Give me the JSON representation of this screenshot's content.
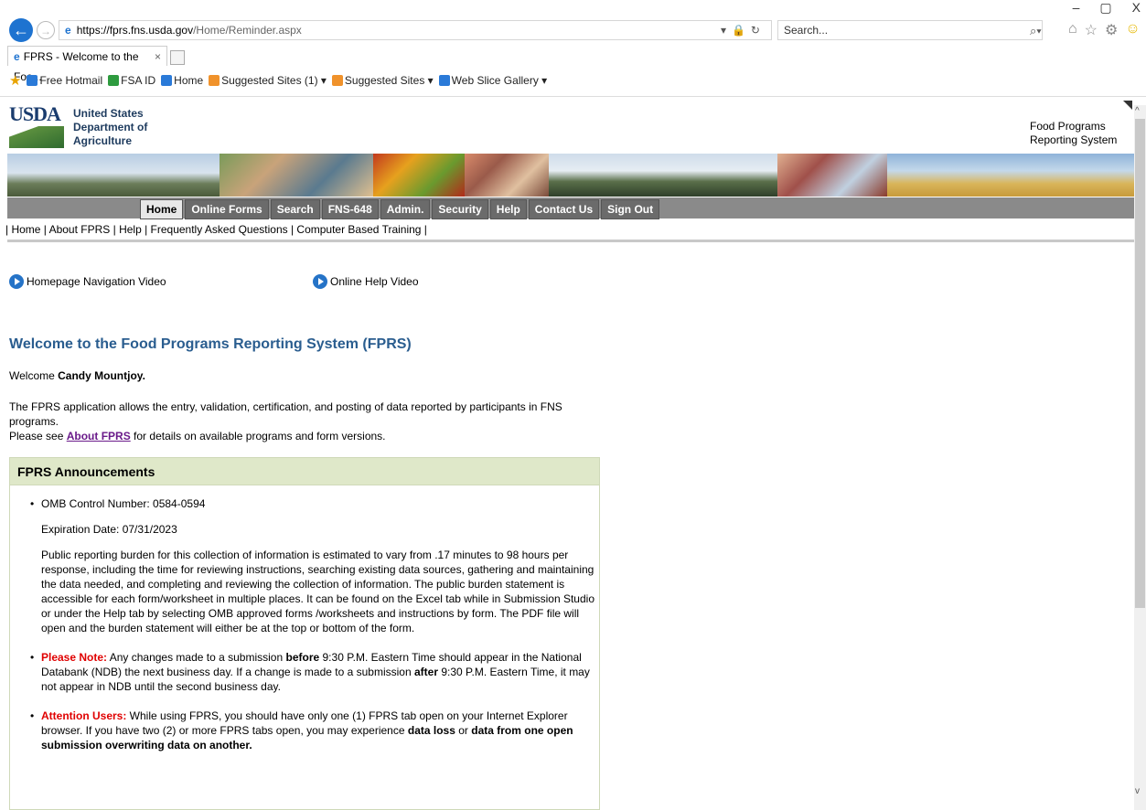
{
  "window": {
    "minimize": "–",
    "restore": "▢",
    "close": "X"
  },
  "browser": {
    "url_host": "https://fprs.fns.usda.gov",
    "url_path": "/Home/Reminder.aspx",
    "search_placeholder": "Search...",
    "tab_title": "FPRS - Welcome to the Foo...",
    "tab_close": "×",
    "favorites": [
      {
        "label": "Free Hotmail",
        "icon": "ie-icon"
      },
      {
        "label": "FSA ID",
        "icon": "fsa-icon"
      },
      {
        "label": "Home",
        "icon": "ie-icon"
      },
      {
        "label": "Suggested Sites (1) ▾",
        "icon": "suggested-sites-icon"
      },
      {
        "label": "Suggested Sites ▾",
        "icon": "suggested-sites-icon"
      },
      {
        "label": "Web Slice Gallery ▾",
        "icon": "ie-icon"
      }
    ]
  },
  "header": {
    "logo_text": "USDA",
    "dept_line1": "United States",
    "dept_line2": "Department of",
    "dept_line3": "Agriculture",
    "system_line1": "Food Programs",
    "system_line2": "Reporting System"
  },
  "nav": {
    "items": [
      "Home",
      "Online Forms",
      "Search",
      "FNS-648",
      "Admin.",
      "Security",
      "Help",
      "Contact Us",
      "Sign Out"
    ],
    "active": "Home"
  },
  "subnav": "| Home | About FPRS | Help | Frequently Asked Questions | Computer Based Training |",
  "videos": {
    "homepage": "Homepage Navigation Video",
    "help": "Online Help Video"
  },
  "welcome": {
    "title": "Welcome to the Food Programs Reporting System (FPRS)",
    "prefix": "Welcome ",
    "user": "Candy Mountjoy.",
    "intro_line1": "The FPRS application allows the entry, validation, certification, and posting of data reported by participants in FNS programs.",
    "intro_pre_link": "Please see ",
    "intro_link": "About FPRS",
    "intro_post_link": " for details on available programs and form versions."
  },
  "announcements": {
    "title": "FPRS Announcements",
    "omb": "OMB Control Number: 0584-0594",
    "expiration": "Expiration Date: 07/31/2023",
    "burden": "Public reporting burden for this collection of information is estimated to vary from .17 minutes to 98 hours per response, including the time for reviewing instructions, searching existing data sources, gathering and maintaining the data needed, and completing and reviewing the collection of information. The public burden statement is accessible for each form/worksheet in multiple places. It can be found on the Excel tab while in Submission Studio or under the Help tab by selecting OMB approved forms /worksheets and instructions by form. The PDF file will open and the burden statement will either be at the top or bottom of the form.",
    "note_label": "Please Note:",
    "note_1": " Any changes made to a submission ",
    "note_before": "before",
    "note_2": " 9:30 P.M. Eastern Time should appear in the National Databank (NDB) the next business day. If a change is made to a submission ",
    "note_after": "after",
    "note_3": " 9:30 P.M. Eastern Time, it may not appear in NDB until the second business day.",
    "attn_label": "Attention Users:",
    "attn_1": " While using FPRS, you should have only one (1) FPRS tab open on your Internet Explorer browser. If you have two (2) or more FPRS tabs open, you may experience ",
    "attn_loss": "data loss",
    "attn_2": " or ",
    "attn_overwrite": "data from one open submission overwriting data on another."
  }
}
